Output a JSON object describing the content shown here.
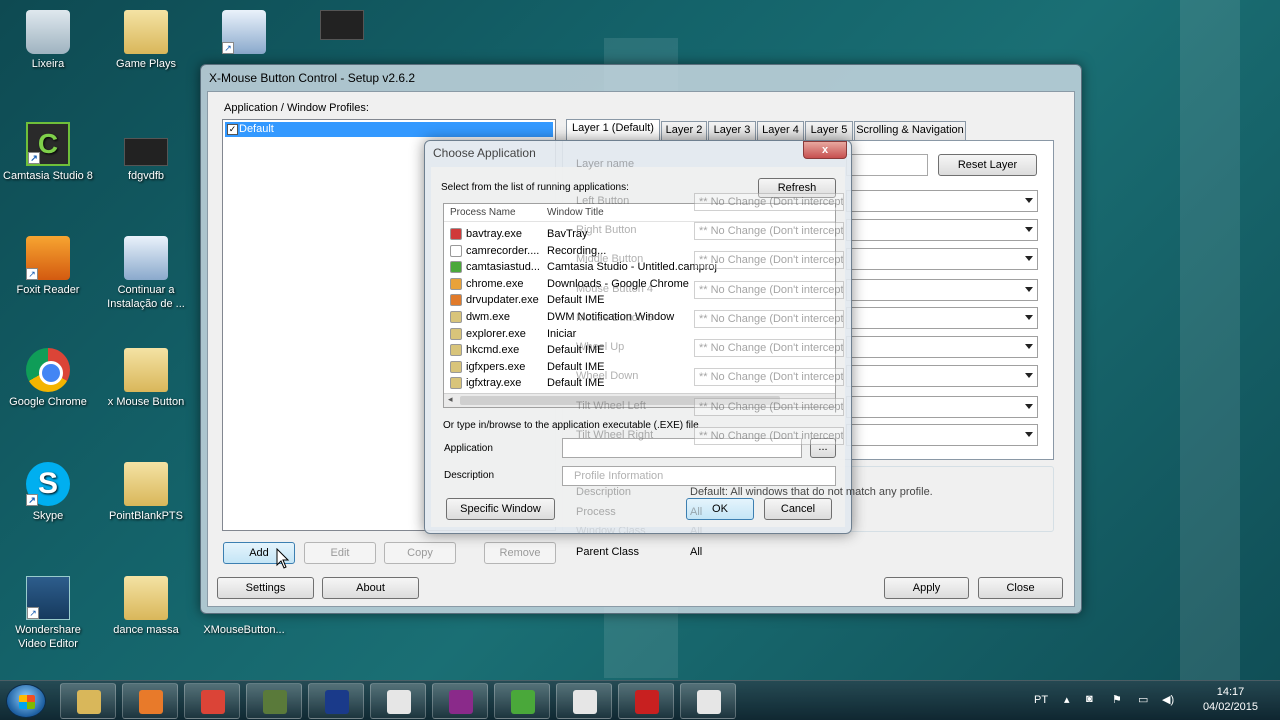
{
  "desktop": {
    "icons": [
      {
        "label": "Lixeira"
      },
      {
        "label": "Game Plays"
      },
      {
        "label": "Camtasia Studio 8"
      },
      {
        "label": "fdgvdfb"
      },
      {
        "label": "Foxit Reader"
      },
      {
        "label": "Continuar a Instalação de ..."
      },
      {
        "label": "Google Chrome"
      },
      {
        "label": "x Mouse Button"
      },
      {
        "label": "Skype"
      },
      {
        "label": "PointBlankPTS"
      },
      {
        "label": "Wondershare Video Editor"
      },
      {
        "label": "dance massa"
      },
      {
        "label": "XMouseButton..."
      }
    ]
  },
  "main_window": {
    "title": "X-Mouse Button Control - Setup v2.6.2",
    "profiles_label": "Application / Window Profiles:",
    "profiles": [
      {
        "label": "Default",
        "checked": true
      }
    ],
    "buttons": {
      "add": "Add",
      "edit": "Edit",
      "copy": "Copy",
      "remove": "Remove",
      "settings": "Settings",
      "about": "About",
      "apply": "Apply",
      "close": "Close"
    },
    "tabs": [
      "Layer 1 (Default)",
      "Layer 2",
      "Layer 3",
      "Layer 4",
      "Layer 5",
      "Scrolling & Navigation"
    ],
    "layer_name_label": "Layer name",
    "reset_layer": "Reset Layer",
    "button_rows": [
      {
        "label": "Left Button",
        "value": "** No Change (Don't intercept) **"
      },
      {
        "label": "Right Button",
        "value": "** No Change (Don't intercept) **"
      },
      {
        "label": "Middle Button",
        "value": "** No Change (Don't intercept) **"
      },
      {
        "label": "Mouse Button 4",
        "value": "** No Change (Don't intercept) **"
      },
      {
        "label": "Mouse Button 5",
        "value": "** No Change (Don't intercept) **"
      },
      {
        "label": "Wheel Up",
        "value": "** No Change (Don't intercept) **"
      },
      {
        "label": "Wheel Down",
        "value": "** No Change (Don't intercept) **"
      },
      {
        "label": "Tilt Wheel Left",
        "value": "** No Change (Don't intercept) **"
      },
      {
        "label": "Tilt Wheel Right",
        "value": "** No Change (Don't intercept) **"
      }
    ],
    "profile_info": {
      "heading": "Profile Information",
      "description_label": "Description",
      "description_value": "Default: All windows that do not match any profile.",
      "process_label": "Process",
      "process_value": "All",
      "window_class_label": "Window Class",
      "window_class_value": "All",
      "parent_class_label": "Parent Class",
      "parent_class_value": "All"
    }
  },
  "dialog": {
    "title": "Choose Application",
    "close_glyph": "x",
    "select_label": "Select from the list of running applications:",
    "refresh": "Refresh",
    "columns": {
      "process": "Process Name",
      "window": "Window Title"
    },
    "processes": [
      {
        "name": "bavtray.exe",
        "title": "BavTray",
        "color": "#d03a3a"
      },
      {
        "name": "camrecorder....",
        "title": "Recording...",
        "color": "#ffffff"
      },
      {
        "name": "camtasiastud...",
        "title": "Camtasia Studio - Untitled.camproj",
        "color": "#4aa83a"
      },
      {
        "name": "chrome.exe",
        "title": "Downloads - Google Chrome",
        "color": "#e8a23a"
      },
      {
        "name": "drvupdater.exe",
        "title": "Default IME",
        "color": "#e07a2a"
      },
      {
        "name": "dwm.exe",
        "title": "DWM Notification Window",
        "color": "#d8c47a"
      },
      {
        "name": "explorer.exe",
        "title": "Iniciar",
        "color": "#d8c47a"
      },
      {
        "name": "hkcmd.exe",
        "title": "Default IME",
        "color": "#d8c47a"
      },
      {
        "name": "igfxpers.exe",
        "title": "Default IME",
        "color": "#d8c47a"
      },
      {
        "name": "igfxtray.exe",
        "title": "Default IME",
        "color": "#d8c47a"
      }
    ],
    "browse_label": "Or type in/browse to the application executable (.EXE) file",
    "application_label": "Application",
    "description_label": "Description",
    "browse_button": "...",
    "specific_window": "Specific Window",
    "ok": "OK",
    "cancel": "Cancel"
  },
  "taskbar": {
    "language": "PT",
    "time": "14:17",
    "date": "04/02/2015",
    "apps": [
      {
        "name": "explorer",
        "color": "#d9b75a"
      },
      {
        "name": "media-player",
        "color": "#e87a2a"
      },
      {
        "name": "chrome",
        "color": "#db4437"
      },
      {
        "name": "game-app",
        "color": "#5a7a3a"
      },
      {
        "name": "point-blank",
        "color": "#1a3a8a"
      },
      {
        "name": "xmouse",
        "color": "#e6e6e6"
      },
      {
        "name": "winrar",
        "color": "#8a2a8a"
      },
      {
        "name": "camtasia-recorder",
        "color": "#4aa83a"
      },
      {
        "name": "camtasia-studio",
        "color": "#e6e6e6"
      },
      {
        "name": "zfx-app",
        "color": "#c82020"
      },
      {
        "name": "xmouse-active",
        "color": "#e6e6e6"
      }
    ]
  }
}
